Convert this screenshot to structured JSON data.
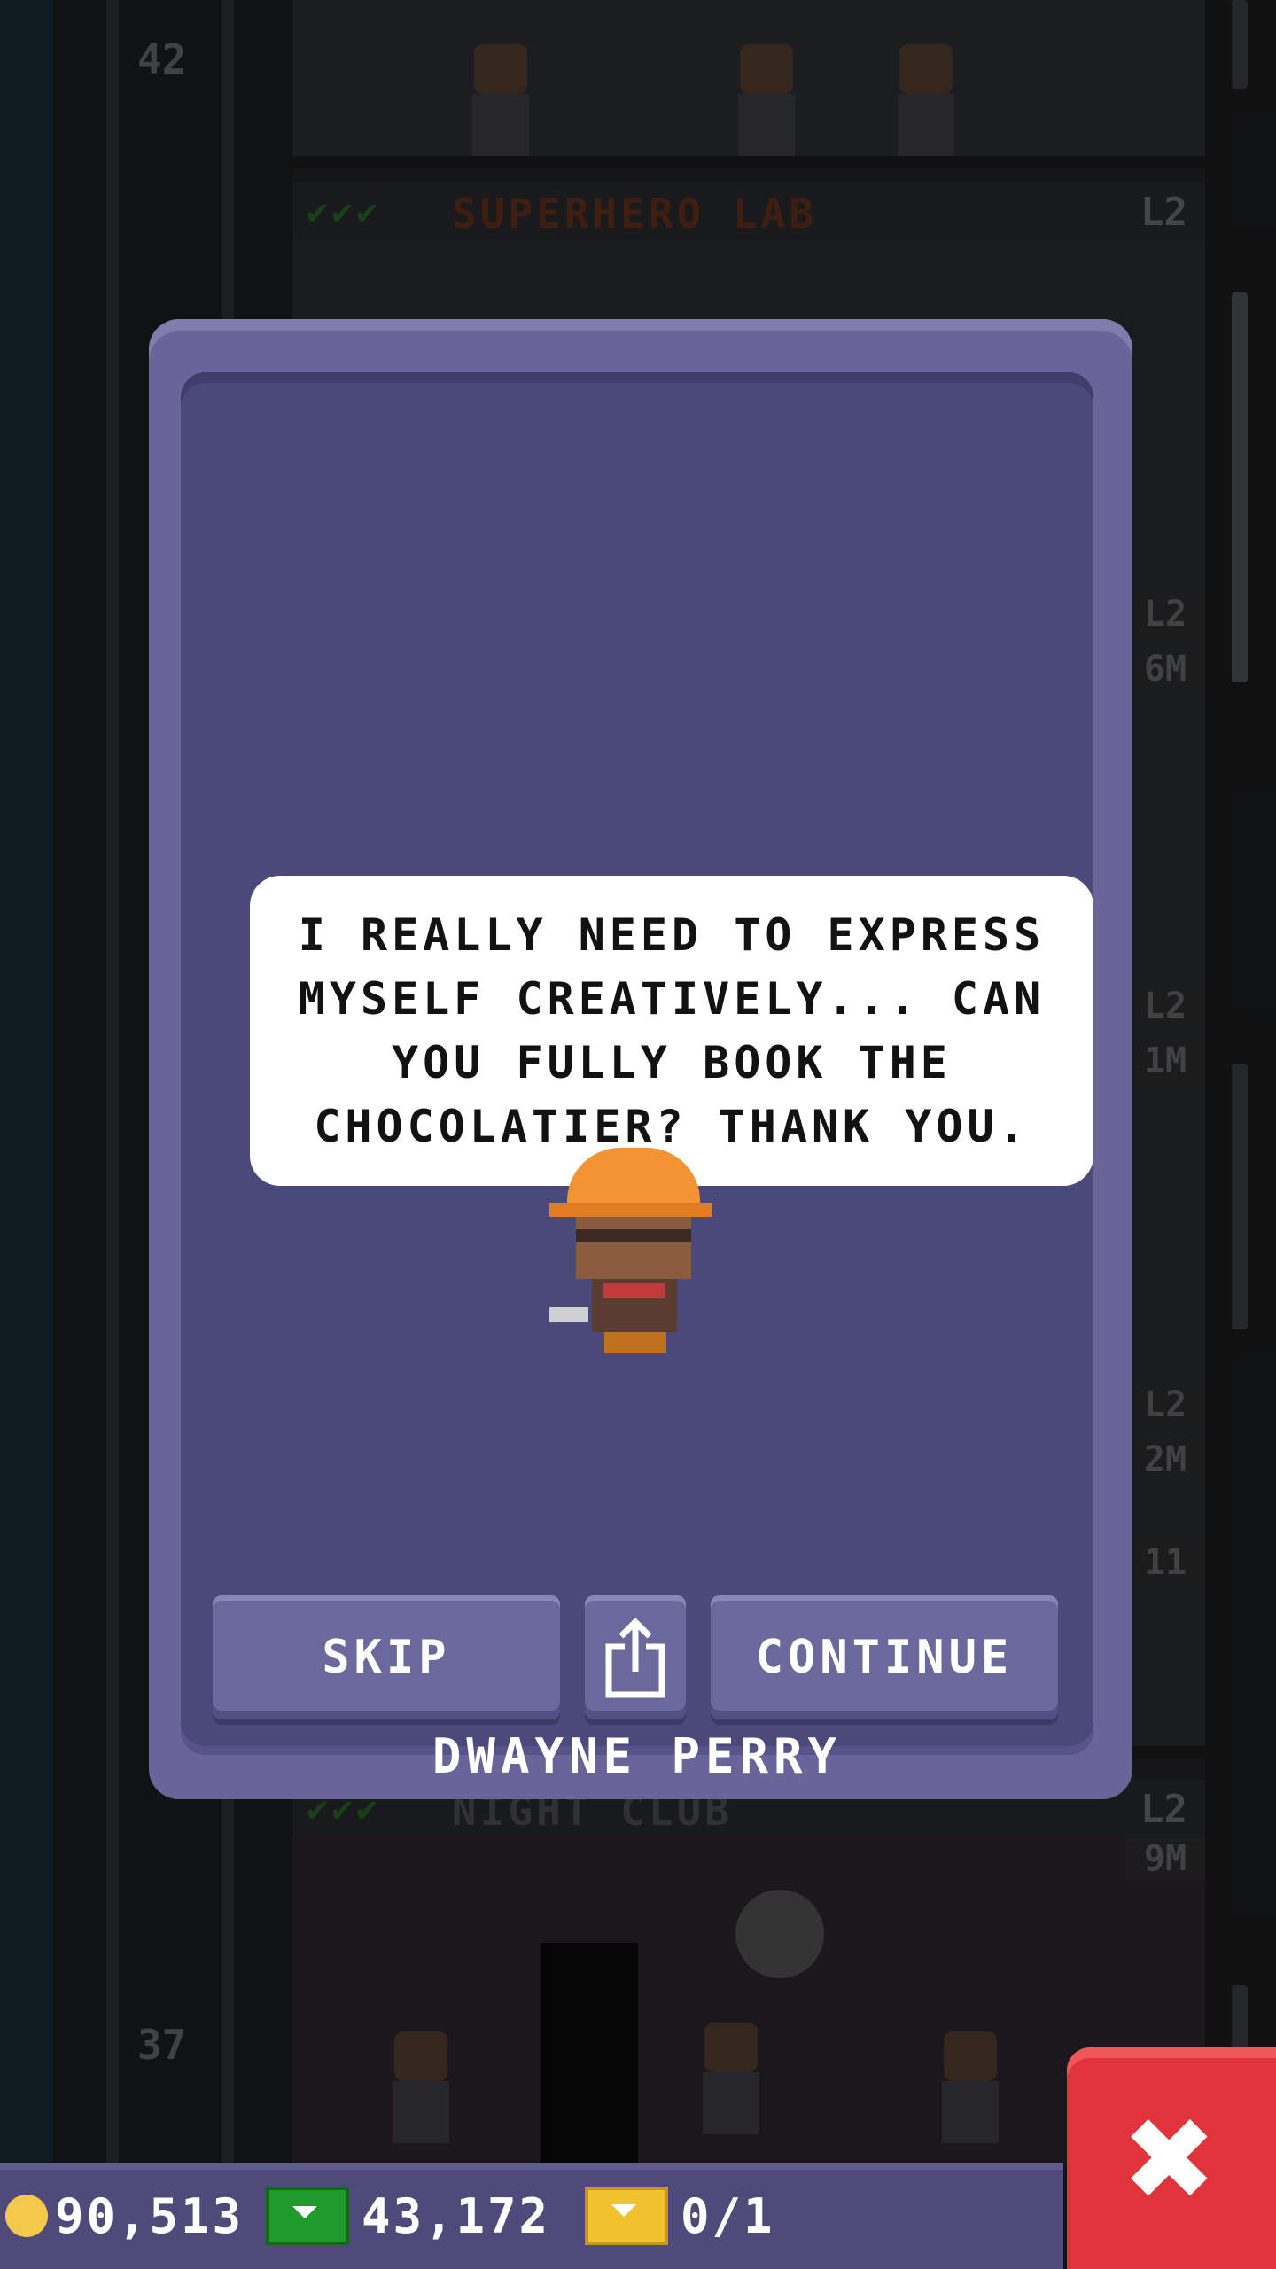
{
  "background": {
    "floors": [
      {
        "number": "42"
      },
      {
        "name": "SUPERHERO LAB",
        "level": "L2",
        "checks": "✔✔✔"
      },
      {
        "name": "NIGHT CLUB",
        "level": "L2",
        "checks": "✔✔✔"
      },
      {
        "number": "37"
      }
    ],
    "side_tags": [
      "L2",
      "6M",
      "L2",
      "1M",
      "L2",
      "2M",
      "11",
      "9M"
    ]
  },
  "dialog": {
    "message": "I REALLY NEED TO EXPRESS\nMYSELF CREATIVELY... CAN\nYOU FULLY BOOK THE\nCHOCOLATIER? THANK YOU.",
    "character_name": "DWAYNE PERRY",
    "skip_label": "SKIP",
    "continue_label": "CONTINUE",
    "share_icon": "share-icon"
  },
  "hud": {
    "coins": "90,513",
    "bux": "43,172",
    "tickets": "0/1"
  },
  "close_icon": "close-icon",
  "colors": {
    "modal_frame": "#6a6598",
    "modal_fill": "#4b487a",
    "close_red": "#e0343a",
    "coin_gold": "#f3c94b",
    "bux_green": "#1e9a2c"
  }
}
